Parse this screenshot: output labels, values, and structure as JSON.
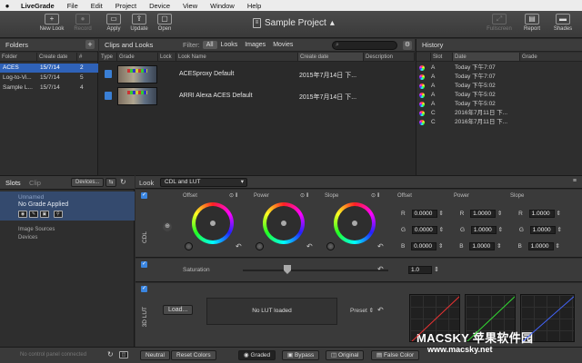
{
  "menubar": {
    "app": "LiveGrade",
    "items": [
      "File",
      "Edit",
      "Project",
      "Device",
      "View",
      "Window",
      "Help"
    ]
  },
  "toolbar": {
    "new_look": "New Look",
    "record": "Record",
    "apply": "Apply",
    "update": "Update",
    "open": "Open",
    "project_title": "Sample Project",
    "fullscreen": "Fullscreen",
    "report": "Report",
    "shades": "Shades"
  },
  "folders": {
    "title": "Folders",
    "add": "+",
    "columns": [
      "Folder",
      "Create date",
      "#"
    ],
    "rows": [
      {
        "name": "ACES",
        "date": "15/7/14",
        "count": "2"
      },
      {
        "name": "Log-to-Vi...",
        "date": "15/7/14",
        "count": "5"
      },
      {
        "name": "Sample L...",
        "date": "15/7/14",
        "count": "4"
      }
    ]
  },
  "clips": {
    "title": "Clips and Looks",
    "filter_label": "Filter:",
    "filters": [
      "All",
      "Looks",
      "Images",
      "Movies"
    ],
    "columns": [
      "Type",
      "Grade",
      "Lock",
      "Look Name",
      "Create date",
      "Description"
    ],
    "rows": [
      {
        "name": "ACESproxy Default",
        "date": "2015年7月14日 下..."
      },
      {
        "name": "ARRI Alexa ACES Default",
        "date": "2015年7月14日 下..."
      }
    ]
  },
  "history": {
    "title": "History",
    "columns": [
      "Slot",
      "Date",
      "Grade"
    ],
    "rows": [
      {
        "slot": "A",
        "date": "Today 下午7:07"
      },
      {
        "slot": "A",
        "date": "Today 下午7:07"
      },
      {
        "slot": "A",
        "date": "Today 下午5:02"
      },
      {
        "slot": "A",
        "date": "Today 下午5:02"
      },
      {
        "slot": "A",
        "date": "Today 下午5:02"
      },
      {
        "slot": "C",
        "date": "2016年7月11日 下..."
      },
      {
        "slot": "C",
        "date": "2016年7月11日 下..."
      }
    ]
  },
  "slots": {
    "tab_slots": "Slots",
    "tab_clip": "Clip",
    "devices_btn": "Devices...",
    "slot_name": "Unnamed",
    "slot_status": "No Grade Applied",
    "image_sources": "Image Sources",
    "devices": "Devices",
    "no_panel": "No control panel connected"
  },
  "look": {
    "label": "Look",
    "mode": "CDL and LUT",
    "cdl_label": "CDL",
    "wheels": [
      "Offset",
      "Power",
      "Slope"
    ],
    "num_headers": [
      "Offset",
      "Power",
      "Slope"
    ],
    "num_rows": [
      {
        "ch": "R",
        "offset": "0.0000",
        "power": "1.0000",
        "slope": "1.0000"
      },
      {
        "ch": "G",
        "offset": "0.0000",
        "power": "1.0000",
        "slope": "1.0000"
      },
      {
        "ch": "B",
        "offset": "0.0000",
        "power": "1.0000",
        "slope": "1.0000"
      }
    ],
    "saturation_label": "Saturation",
    "saturation_value": "1.0",
    "lut_label": "3D LUT",
    "load_btn": "Load...",
    "no_lut": "No LUT loaded",
    "preset": "Preset"
  },
  "bottombar": {
    "neutral": "Neutral",
    "reset_colors": "Reset Colors",
    "graded": "Graded",
    "bypass": "Bypass",
    "original": "Original",
    "false_color": "False Color"
  },
  "watermark": {
    "brand": "MACSKY 苹果软件园",
    "url": "www.macsky.net"
  },
  "colors": {
    "accent": "#2f62b8",
    "checkbox": "#3a85e0"
  }
}
